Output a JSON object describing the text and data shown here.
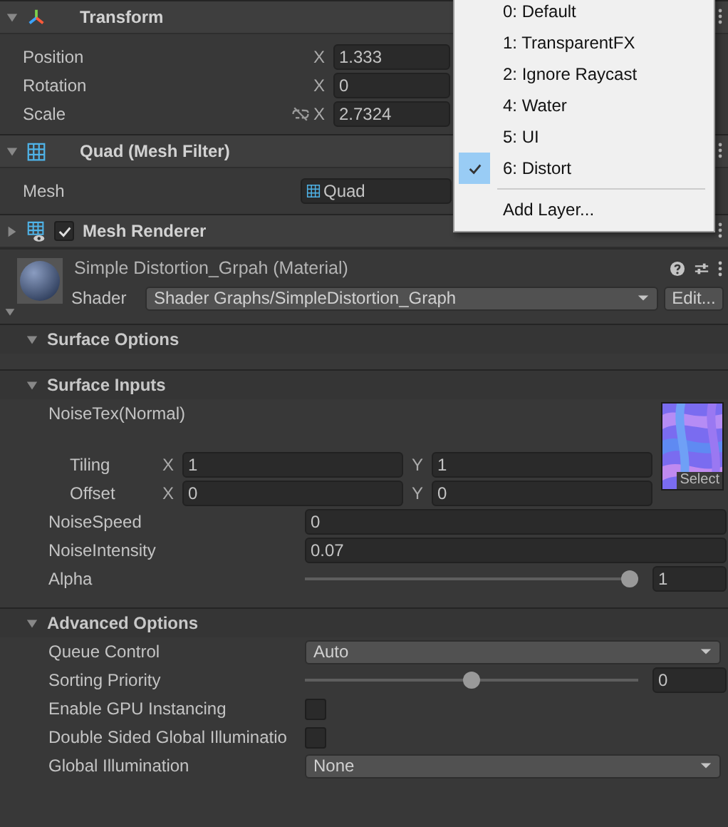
{
  "transform": {
    "title": "Transform",
    "expanded": true,
    "rows": [
      {
        "kind": "vector",
        "label": "Position",
        "axis": "X",
        "value": "1.333"
      },
      {
        "kind": "vector",
        "label": "Rotation",
        "axis": "X",
        "value": "0"
      },
      {
        "kind": "scale",
        "label": "Scale",
        "axis": "X",
        "value": "2.7324"
      }
    ]
  },
  "mesh_filter": {
    "title": "Quad (Mesh Filter)",
    "expanded": true,
    "label": "Mesh",
    "value": "Quad"
  },
  "mesh_renderer": {
    "title": "Mesh Renderer",
    "expanded": false,
    "enabled": true
  },
  "material": {
    "title": "Simple Distortion_Grpah (Material)",
    "shader_label": "Shader",
    "shader": "Shader Graphs/SimpleDistortion_Graph",
    "edit_button": "Edit..."
  },
  "sections": [
    {
      "title": "Surface Options",
      "expanded": true
    },
    {
      "title": "Surface Inputs",
      "expanded": true,
      "rows": [
        {
          "kind": "texture",
          "label": "NoiseTex(Normal)",
          "select": "Select",
          "vectors": [
            {
              "label": "Tiling",
              "fields": [
                {
                  "axis": "X",
                  "value": "1"
                },
                {
                  "axis": "Y",
                  "value": "1"
                }
              ]
            },
            {
              "label": "Offset",
              "fields": [
                {
                  "axis": "X",
                  "value": "0"
                },
                {
                  "axis": "Y",
                  "value": "0"
                }
              ]
            }
          ]
        },
        {
          "kind": "float",
          "label": "NoiseSpeed",
          "value": "0"
        },
        {
          "kind": "float",
          "label": "NoiseIntensity",
          "value": "0.07"
        },
        {
          "kind": "slider",
          "label": "Alpha",
          "level": 1,
          "value": "1"
        }
      ]
    },
    {
      "title": "Advanced Options",
      "expanded": true,
      "rows": [
        {
          "kind": "dropdown",
          "label": "Queue Control",
          "value": "Auto"
        },
        {
          "kind": "slider",
          "label": "Sorting Priority",
          "level": 0.5,
          "value": "0"
        },
        {
          "kind": "checkbox",
          "label": "Enable GPU Instancing",
          "checked": false
        },
        {
          "kind": "checkbox",
          "label": "Double Sided Global Illuminatio",
          "checked": false
        },
        {
          "kind": "dropdown",
          "label": "Global Illumination",
          "value": "None"
        }
      ]
    }
  ],
  "layer_menu": {
    "items": [
      {
        "label": "0: Default",
        "selected": false
      },
      {
        "label": "1: TransparentFX",
        "selected": false
      },
      {
        "label": "2: Ignore Raycast",
        "selected": false
      },
      {
        "label": "4: Water",
        "selected": false
      },
      {
        "label": "5: UI",
        "selected": false
      },
      {
        "label": "6: Distort",
        "selected": true
      }
    ],
    "add": "Add Layer..."
  }
}
